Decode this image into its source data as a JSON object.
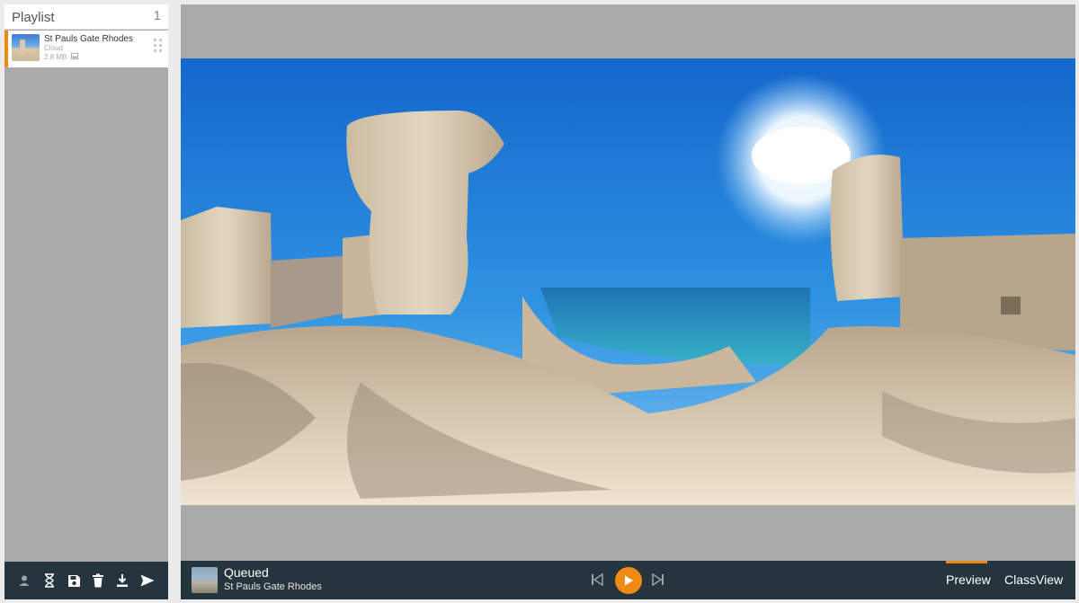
{
  "playlist": {
    "title": "Playlist",
    "count": "1",
    "items": [
      {
        "name": "St Pauls Gate Rhodes",
        "source": "Cloud",
        "size": "2.8 MB"
      }
    ]
  },
  "toolbar": {
    "icons": [
      "user-icon",
      "hourglass-icon",
      "save-icon",
      "trash-icon",
      "download-icon",
      "send-icon"
    ]
  },
  "player": {
    "status": "Queued",
    "title": "St Pauls Gate Rhodes"
  },
  "tabs": {
    "preview": "Preview",
    "classview": "ClassView",
    "active": "Preview"
  },
  "colors": {
    "accent": "#ef8b14",
    "bar": "#26343d",
    "panel": "#aaaaaa"
  }
}
